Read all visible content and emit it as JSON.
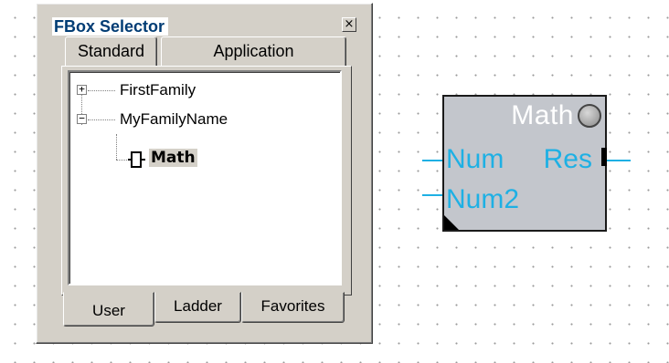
{
  "window": {
    "title": "FBox Selector",
    "close_glyph": "×",
    "close_icon": "close-icon"
  },
  "tabs_top": [
    {
      "label": "Standard",
      "active": false
    },
    {
      "label": "Application",
      "active": false
    }
  ],
  "tree": {
    "items": [
      {
        "label": "FirstFamily",
        "expander": "+",
        "expander_icon": "plus-box-icon"
      },
      {
        "label": "MyFamilyName",
        "expander": "−",
        "expander_icon": "minus-box-icon"
      },
      {
        "label": "Math",
        "icon": "fbox-block-icon",
        "selected": true
      }
    ]
  },
  "tabs_bottom": [
    {
      "label": "User",
      "active": true
    },
    {
      "label": "Ladder",
      "active": false
    },
    {
      "label": "Favorites",
      "active": false
    }
  ],
  "canvas": {
    "fbox": {
      "title": "Math",
      "inputs": [
        "Num",
        "Num2"
      ],
      "output": "Res",
      "status_icon": "status-led-icon"
    },
    "colors": {
      "port_text": "#1eb0e4",
      "fbox_body": "#c3c6cc",
      "title_text": "#ffffff"
    }
  }
}
